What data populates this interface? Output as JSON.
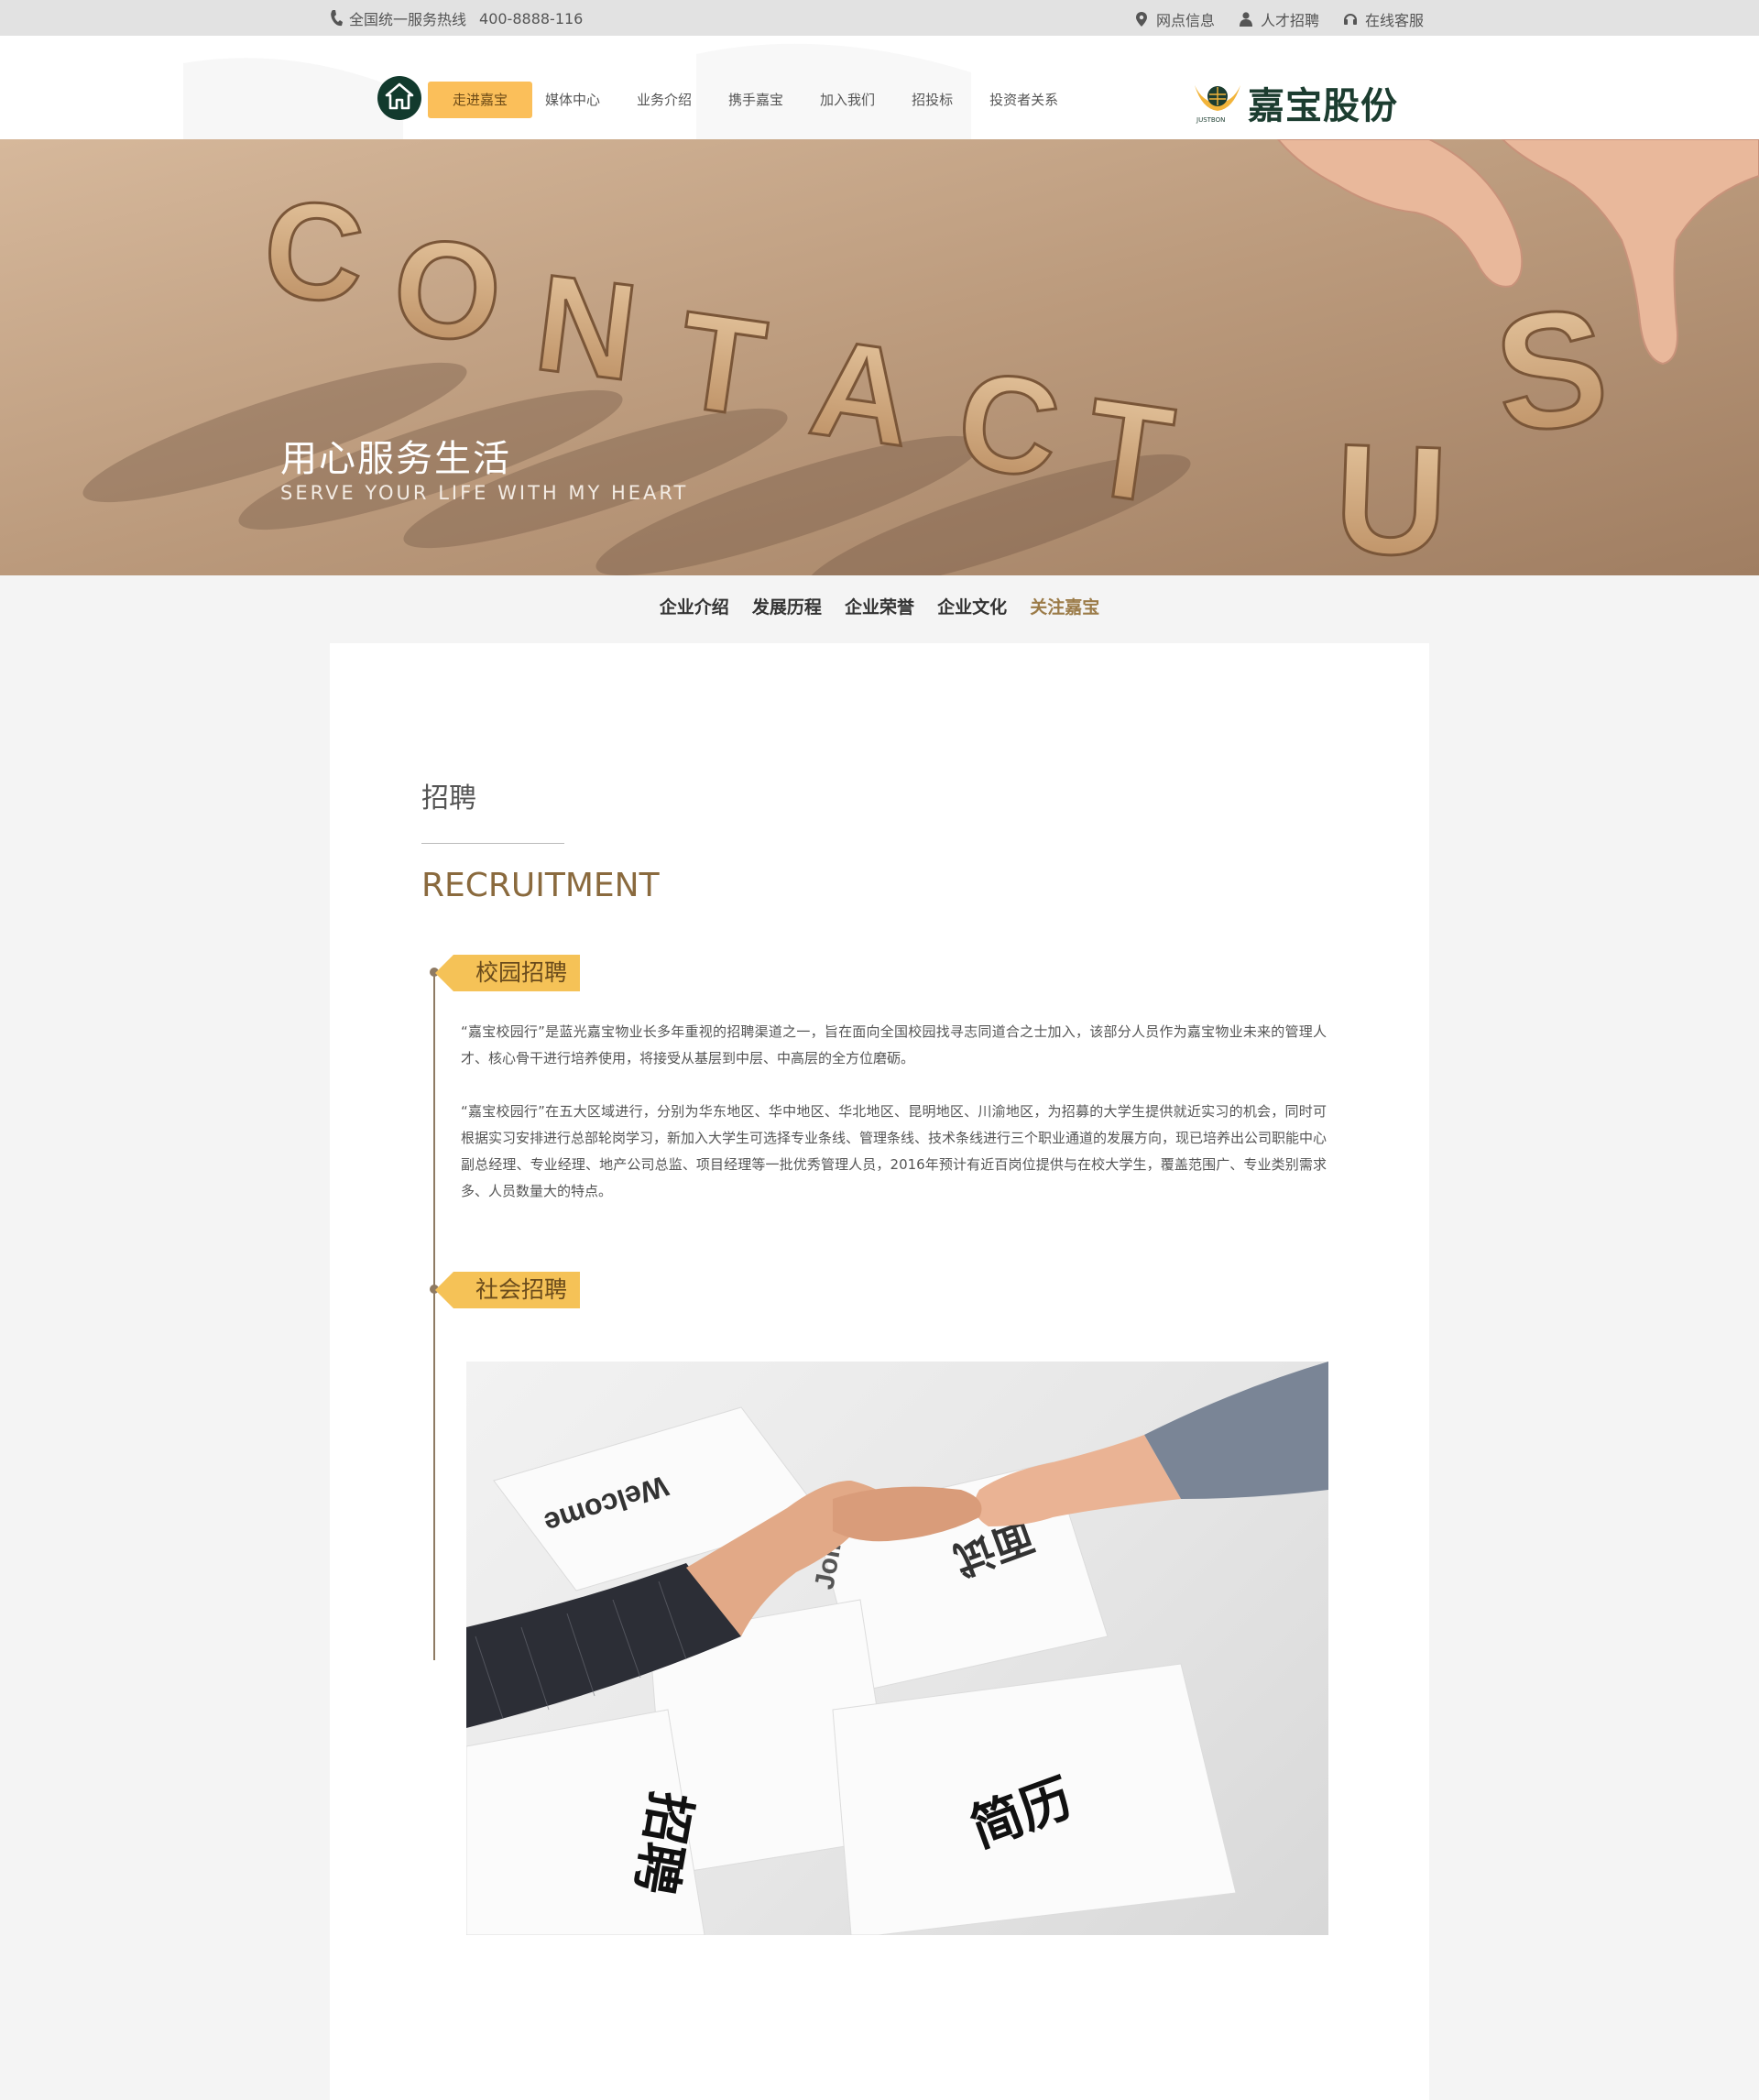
{
  "topbar": {
    "hotline_label": "全国统一服务热线",
    "hotline_number": "400-8888-116",
    "links": [
      {
        "label": "网点信息",
        "icon": "location-pin-icon"
      },
      {
        "label": "人才招聘",
        "icon": "person-icon"
      },
      {
        "label": "在线客服",
        "icon": "headset-icon"
      }
    ]
  },
  "header": {
    "nav": [
      "走进嘉宝",
      "媒体中心",
      "业务介绍",
      "携手嘉宝",
      "加入我们",
      "招投标",
      "投资者关系"
    ],
    "logo_text": "嘉宝股份",
    "logo_sub": "JUSTBON",
    "accent": "#fbbf5a"
  },
  "banner": {
    "letters": "CONTACT US",
    "slogan": "用心服务生活",
    "slogan_en": "SERVE YOUR LIFE WITH MY HEART"
  },
  "subnav": [
    "企业介绍",
    "发展历程",
    "企业荣誉",
    "企业文化",
    "关注嘉宝"
  ],
  "content": {
    "title_cn": "招聘",
    "title_en": "RECRUITMENT",
    "sections": [
      {
        "tag": "校园招聘",
        "paragraphs": [
          "“嘉宝校园行”是蓝光嘉宝物业长多年重视的招聘渠道之一，旨在面向全国校园找寻志同道合之士加入，该部分人员作为嘉宝物业未来的管理人才、核心骨干进行培养使用，将接受从基层到中层、中高层的全方位磨砺。",
          "“嘉宝校园行”在五大区域进行，分别为华东地区、华中地区、华北地区、昆明地区、川渝地区，为招募的大学生提供就近实习的机会，同时可根据实习安排进行总部轮岗学习，新加入大学生可选择专业条线、管理条线、技术条线进行三个职业通道的发展方向，现已培养出公司职能中心副总经理、专业经理、地产公司总监、项目经理等一批优秀管理人员，2016年预计有近百岗位提供与在校大学生，覆盖范围广、专业类别需求多、人员数量大的特点。"
        ]
      },
      {
        "tag": "社会招聘",
        "photo_words": [
          "Welcome",
          "Join Us",
          "招聘",
          "简历",
          "面试"
        ]
      }
    ]
  }
}
